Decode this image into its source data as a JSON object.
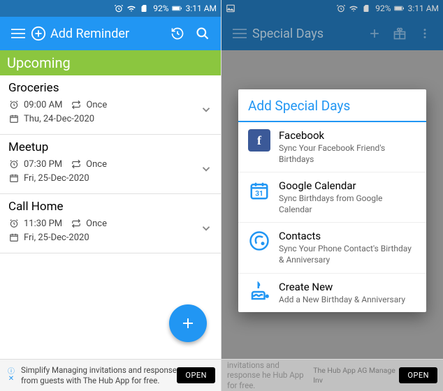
{
  "status": {
    "battery": "92%",
    "time": "3:11 AM"
  },
  "left": {
    "addReminder": "Add Reminder",
    "section": "Upcoming",
    "reminders": [
      {
        "title": "Groceries",
        "time": "09:00 AM",
        "repeat": "Once",
        "date": "Thu, 24-Dec-2020"
      },
      {
        "title": "Meetup",
        "time": "07:30 PM",
        "repeat": "Once",
        "date": "Fri, 25-Dec-2020"
      },
      {
        "title": "Call Home",
        "time": "11:30 PM",
        "repeat": "Once",
        "date": "Fri, 25-Dec-2020"
      }
    ],
    "ad": {
      "text": "Simplify Managing invitations and response from guests with The Hub App for free.",
      "button": "OPEN"
    }
  },
  "right": {
    "title": "Special Days",
    "dialogTitle": "Add Special Days",
    "options": [
      {
        "label": "Facebook",
        "sub": "Sync Your Facebook Friend's Birthdays"
      },
      {
        "label": "Google Calendar",
        "sub": "Sync Birthdays from Google Calendar"
      },
      {
        "label": "Contacts",
        "sub": "Sync Your Phone Contact's Birthday & Anniversary"
      },
      {
        "label": "Create New",
        "sub": "Add a New Birthday & Anniversary"
      }
    ],
    "ad": {
      "text1": "invitations and response he Hub App for free.",
      "text2": "The Hub App AG Manage Inv",
      "button": "OPEN"
    }
  }
}
